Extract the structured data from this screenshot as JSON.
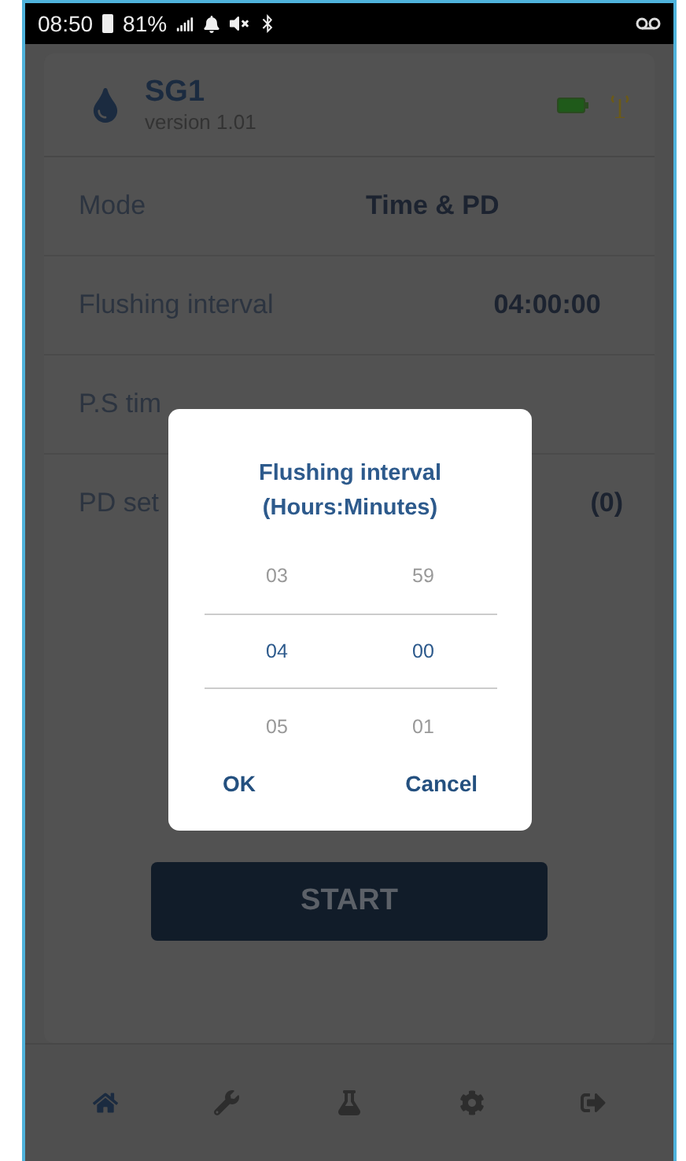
{
  "status_bar": {
    "time": "08:50",
    "battery": "81%"
  },
  "device": {
    "name": "SG1",
    "version": "version 1.01"
  },
  "settings": [
    {
      "label": "Mode",
      "value": "Time & PD"
    },
    {
      "label": "Flushing interval",
      "value": "04:00:00"
    },
    {
      "label": "P.S tim"
    },
    {
      "label": "PD set",
      "value": "(0)"
    }
  ],
  "start_button": "START",
  "dialog": {
    "title": "Flushing interval",
    "subtitle": "(Hours:Minutes)",
    "columns": [
      [
        {
          "text": "03",
          "selected": false
        },
        {
          "text": "04",
          "selected": true
        },
        {
          "text": "05",
          "selected": false
        }
      ],
      [
        {
          "text": "59",
          "selected": false
        },
        {
          "text": "00",
          "selected": true
        },
        {
          "text": "01",
          "selected": false
        }
      ]
    ],
    "buttons": [
      "OK",
      "Cancel"
    ]
  },
  "nav": [
    {
      "kind": "home",
      "selected": true
    },
    {
      "kind": "wrench",
      "selected": false
    },
    {
      "kind": "flask",
      "selected": false
    },
    {
      "kind": "gear",
      "selected": false
    },
    {
      "kind": "logout",
      "selected": false
    }
  ]
}
